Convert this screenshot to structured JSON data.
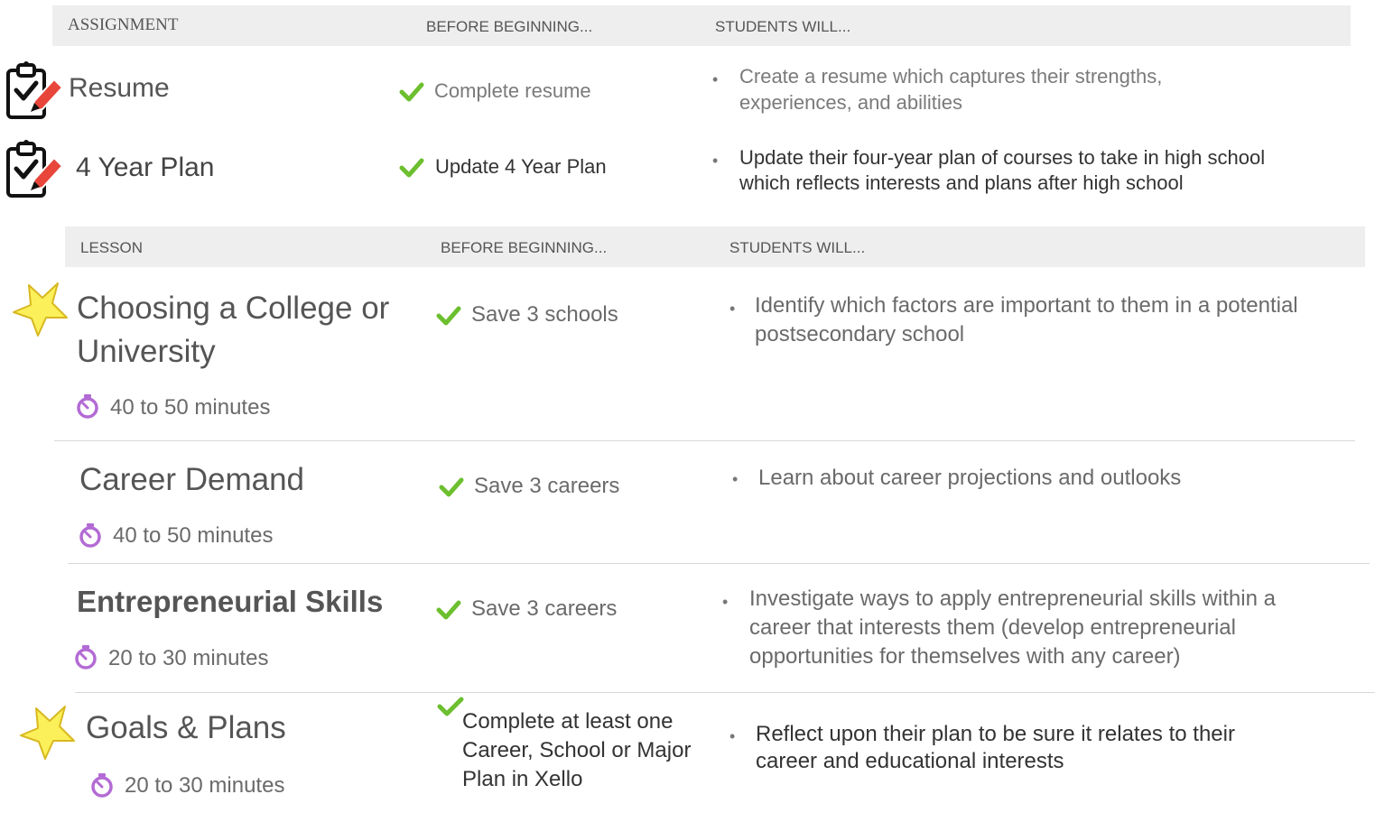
{
  "assignments": {
    "headers": {
      "col1": "ASSIGNMENT",
      "col2": "BEFORE BEGINNING...",
      "col3": "STUDENTS WILL..."
    },
    "rows": [
      {
        "title": "Resume",
        "prereq": "Complete resume",
        "outcome": "Create a resume which captures their strengths, experiences, and abilities",
        "icon": "clipboard-check-pencil-icon"
      },
      {
        "title": "4 Year Plan",
        "prereq": "Update 4 Year Plan",
        "outcome": "Update their four-year plan of courses to take in high school which reflects interests and plans after high school",
        "icon": "clipboard-check-pencil-icon"
      }
    ]
  },
  "lessons": {
    "headers": {
      "col1": "LESSON",
      "col2": "BEFORE BEGINNING...",
      "col3": "STUDENTS WILL..."
    },
    "rows": [
      {
        "title": "Choosing a College or University",
        "duration": "40 to 50 minutes",
        "prereq": "Save 3 schools",
        "outcome": "Identify which factors are important to them in a potential postsecondary school",
        "starred": true
      },
      {
        "title": "Career Demand",
        "duration": "40 to 50 minutes",
        "prereq": "Save 3 careers",
        "outcome": "Learn about career projections and outlooks",
        "starred": false
      },
      {
        "title": "Entrepreneurial Skills",
        "duration": "20 to 30 minutes",
        "prereq": "Save 3 careers",
        "outcome": "Investigate ways to apply entrepreneurial skills within a career that interests them (develop entrepreneurial opportunities for themselves with any career)",
        "starred": false
      },
      {
        "title": "Goals & Plans",
        "duration": "20 to 30 minutes",
        "prereq": "Complete at least one Career, School or Major Plan in Xello",
        "outcome": "Reflect upon their plan to be sure it relates to their career and educational interests",
        "starred": true
      }
    ]
  },
  "colors": {
    "check": "#6cbf2e",
    "timer": "#b36bd4",
    "star_fill": "#fbf05a",
    "star_stroke": "#d8b820",
    "pencil": "#e8463a",
    "header_bg": "#eeeeee"
  }
}
